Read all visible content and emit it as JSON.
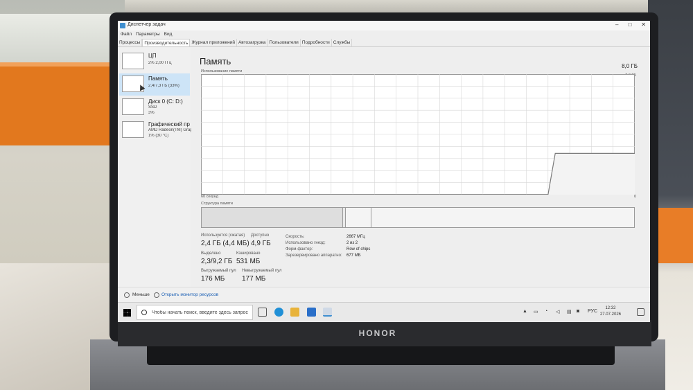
{
  "device": {
    "brand": "HONOR"
  },
  "window": {
    "title": "Диспетчер задач",
    "controls": {
      "minimize": "–",
      "maximize": "□",
      "close": "✕"
    }
  },
  "menu": [
    "Файл",
    "Параметры",
    "Вид"
  ],
  "tabs": [
    "Процессы",
    "Производительность",
    "Журнал приложений",
    "Автозагрузка",
    "Пользователи",
    "Подробности",
    "Службы"
  ],
  "active_tab": "Производительность",
  "sidebar": {
    "items": [
      {
        "name": "ЦП",
        "sub1": "2% 2,00 ГГц",
        "sub2": "",
        "active": false
      },
      {
        "name": "Память",
        "sub1": "2,4/7,3 ГБ (33%)",
        "sub2": "",
        "active": true
      },
      {
        "name": "Диск 0 (C: D:)",
        "sub1": "SSD",
        "sub2": "3%",
        "active": false
      },
      {
        "name": "Графический процессор",
        "sub1": "AMD Radeon(TM) Graphics",
        "sub2": "1% (30 °C)",
        "active": false
      }
    ]
  },
  "main": {
    "title": "Память",
    "total": "8,0 ГБ",
    "usage_label": "Использование памяти",
    "usage_max": "7,3 ГБ",
    "axis_left": "60 секунд",
    "axis_right": "0",
    "structure_label": "Структура памяти",
    "stats": {
      "in_use_label": "Используется (сжатая)",
      "in_use": "2,4 ГБ (4,4 МБ)",
      "available_label": "Доступно",
      "available": "4,9 ГБ",
      "committed_label": "Выделено",
      "committed": "2,3/9,2 ГБ",
      "cached_label": "Кэшировано",
      "cached": "531 МБ",
      "paged_label": "Выгружаемый пул",
      "paged": "176 МБ",
      "nonpaged_label": "Невыгружаемый пул",
      "nonpaged": "177 МБ"
    },
    "properties": [
      {
        "label": "Скорость:",
        "value": "2667 МГц"
      },
      {
        "label": "Использовано гнезд:",
        "value": "2 из 2"
      },
      {
        "label": "Форм-фактор:",
        "value": "Row of chips"
      },
      {
        "label": "Зарезервировано аппаратно:",
        "value": "677 МБ"
      }
    ]
  },
  "footer": {
    "less": "Меньше",
    "monitor": "Открыть монитор ресурсов"
  },
  "taskbar": {
    "search_placeholder": "Чтобы начать поиск, введите здесь запрос",
    "lang": "РУС",
    "time": "12:32",
    "date": "27.07.2026"
  },
  "colors": {
    "accent": "#3f8fd0",
    "selected": "#cde4f7",
    "grid": "#d7d7d7",
    "line": "#7a7a7a"
  },
  "chart_data": {
    "type": "line",
    "title": "Использование памяти",
    "xlabel": "60 секунд",
    "ylabel": "",
    "xlim": [
      60,
      0
    ],
    "ylim": [
      0,
      7.3
    ],
    "x": [
      60,
      12,
      11,
      0
    ],
    "series": [
      {
        "values": [
          0,
          0,
          2.5,
          2.5
        ]
      }
    ]
  }
}
